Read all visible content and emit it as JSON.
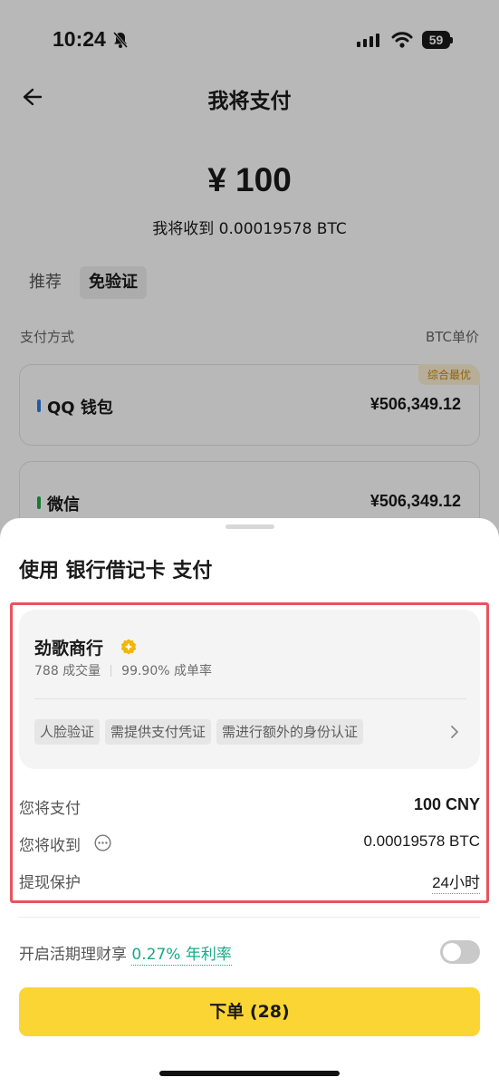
{
  "status_bar": {
    "time": "10:24",
    "battery": "59"
  },
  "header": {
    "title": "我将支付"
  },
  "summary": {
    "amount": "¥ 100",
    "receive_text": "我将收到 0.00019578 BTC"
  },
  "tabs": [
    {
      "label": "推荐",
      "active": false
    },
    {
      "label": "免验证",
      "active": true
    }
  ],
  "columns": {
    "left": "支付方式",
    "right": "BTC单价"
  },
  "payment_methods": [
    {
      "name": "QQ 钱包",
      "price": "¥506,349.12",
      "badge": "综合最优",
      "color": "#2f7fe6"
    },
    {
      "name": "微信",
      "price": "¥506,349.12",
      "color": "#20a84a"
    }
  ],
  "sheet": {
    "title": "使用 银行借记卡 支付",
    "merchant": {
      "name": "劲歌商行",
      "trades": "788 成交量",
      "completion": "99.90% 成单率",
      "tags": [
        "人脸验证",
        "需提供支付凭证",
        "需进行额外的身份认证"
      ]
    },
    "rows": [
      {
        "label": "您将支付",
        "value": "100 CNY"
      },
      {
        "label": "您将收到",
        "value": "0.00019578 BTC"
      },
      {
        "label": "提现保护",
        "value": "24小时"
      }
    ],
    "earn": {
      "label": "开启活期理财享",
      "rate": "0.27% 年利率",
      "enabled": false
    },
    "order_button": "下单 (28)"
  },
  "colors": {
    "accent": "#fbd534",
    "highlight": "#e8535f",
    "green": "#17a987"
  }
}
